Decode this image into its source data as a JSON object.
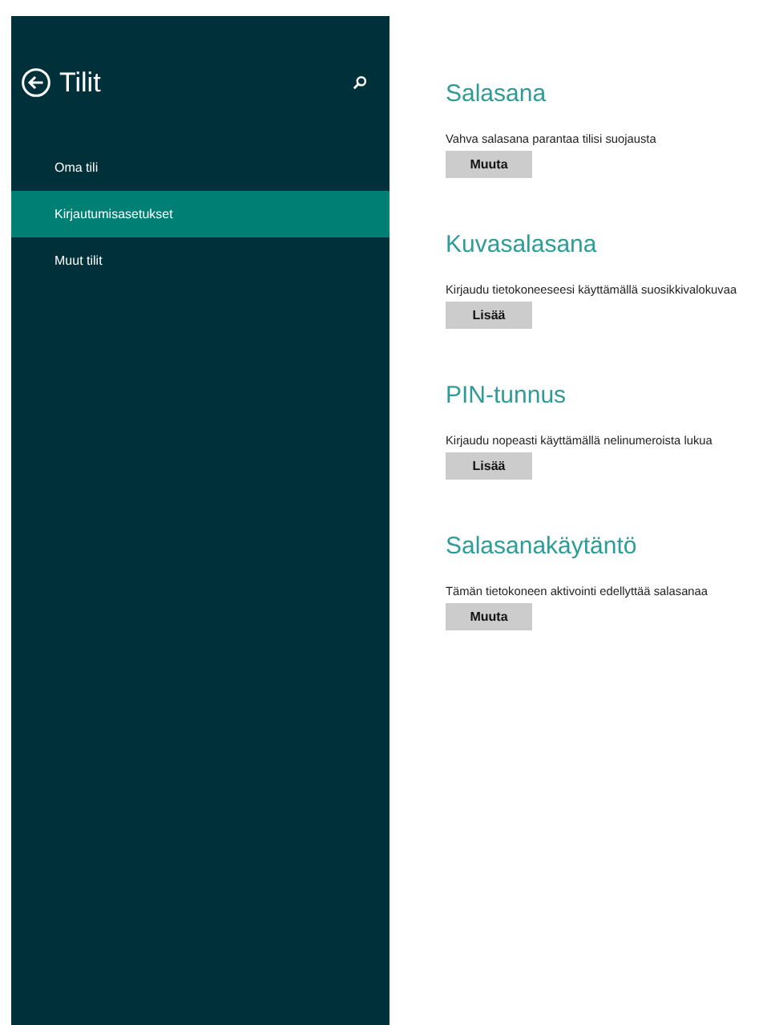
{
  "sidebar": {
    "title": "Tilit",
    "items": [
      {
        "label": "Oma tili",
        "selected": false
      },
      {
        "label": "Kirjautumisasetukset",
        "selected": true
      },
      {
        "label": "Muut tilit",
        "selected": false
      }
    ]
  },
  "sections": [
    {
      "heading": "Salasana",
      "description": "Vahva salasana parantaa tilisi suojausta",
      "button": "Muuta"
    },
    {
      "heading": "Kuvasalasana",
      "description": "Kirjaudu tietokoneeseesi käyttämällä suosikkivalokuvaa",
      "button": "Lisää"
    },
    {
      "heading": "PIN-tunnus",
      "description": "Kirjaudu nopeasti käyttämällä nelinumeroista lukua",
      "button": "Lisää"
    },
    {
      "heading": "Salasanakäytäntö",
      "description": "Tämän tietokoneen aktivointi edellyttää salasanaa",
      "button": "Muuta"
    }
  ]
}
